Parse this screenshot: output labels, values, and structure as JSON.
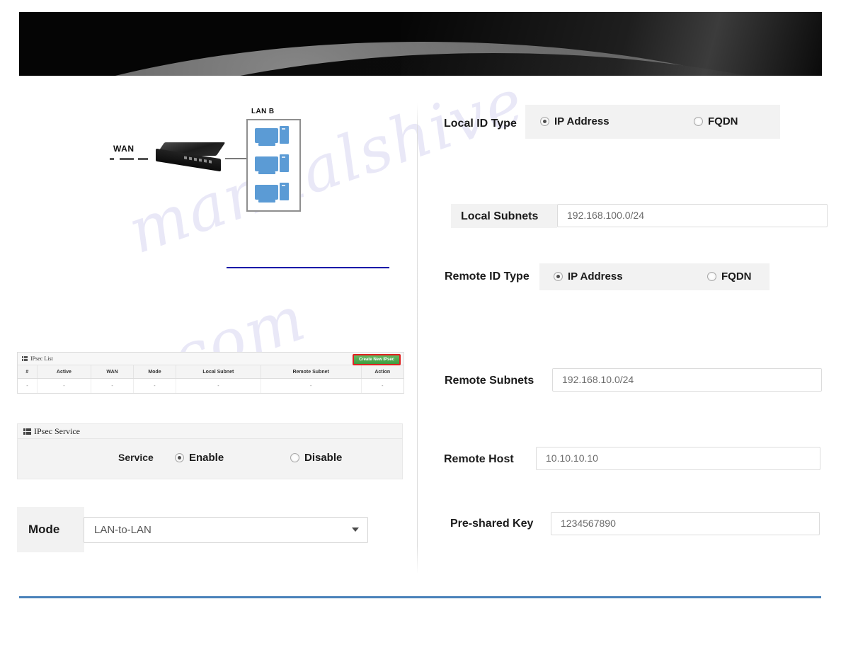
{
  "banner": {
    "alt": "product-banner"
  },
  "watermark": {
    "line1": "manualshive",
    "line2": ".com"
  },
  "diagram": {
    "wan_label": "WAN",
    "lan_label": "LAN B",
    "pc_count": 3
  },
  "ipsec_list": {
    "panel_title": "IPsec List",
    "create_button": "Create New IPsec",
    "columns": [
      "#",
      "Active",
      "WAN",
      "Mode",
      "Local Subnet",
      "Remote Subnet",
      "Action"
    ],
    "rows": [
      [
        "-",
        "-",
        "-",
        "-",
        "-",
        "-",
        "-"
      ]
    ]
  },
  "ipsec_service": {
    "panel_title": "IPsec Service",
    "service_label": "Service",
    "options": [
      {
        "label": "Enable",
        "selected": true
      },
      {
        "label": "Disable",
        "selected": false
      }
    ]
  },
  "mode": {
    "label": "Mode",
    "value": "LAN-to-LAN",
    "options": [
      "LAN-to-LAN"
    ]
  },
  "form": {
    "local_id_type": {
      "label": "Local ID Type",
      "options": [
        {
          "label": "IP Address",
          "selected": true
        },
        {
          "label": "FQDN",
          "selected": false
        }
      ]
    },
    "local_subnets": {
      "label": "Local Subnets",
      "value": "192.168.100.0/24"
    },
    "remote_id_type": {
      "label": "Remote ID Type",
      "options": [
        {
          "label": "IP Address",
          "selected": true
        },
        {
          "label": "FQDN",
          "selected": false
        }
      ]
    },
    "remote_subnets": {
      "label": "Remote Subnets",
      "value": "192.168.10.0/24"
    },
    "remote_host": {
      "label": "Remote Host",
      "value": "10.10.10.10"
    },
    "pre_shared_key": {
      "label": "Pre-shared Key",
      "value": "1234567890"
    }
  },
  "colors": {
    "accent_blue": "#4a82ba",
    "button_green": "#3f9b3f",
    "highlight_red": "#e02020",
    "pc_blue": "#5b9bd5",
    "link_blue": "#1a1aa8"
  }
}
